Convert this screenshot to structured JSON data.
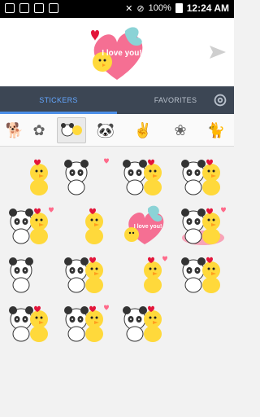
{
  "status": {
    "battery_percent": "100%",
    "time": "12:24 AM"
  },
  "preview": {
    "text": "I love you!"
  },
  "tabs": [
    {
      "label": "STICKERS",
      "active": true
    },
    {
      "label": "FAVORITES",
      "active": false
    }
  ],
  "colors": {
    "tabbar_bg": "#3c4654",
    "active_tab_text": "#63a7ff",
    "accent": "#4c8fe8"
  },
  "packs": [
    {
      "icon": "dog-pack-icon"
    },
    {
      "icon": "rose-pack-icon"
    },
    {
      "icon": "panda-duck-pack-icon",
      "selected": true
    },
    {
      "icon": "panda-pack-icon"
    },
    {
      "icon": "rabbit-pack-icon"
    },
    {
      "icon": "flower-pack-icon"
    },
    {
      "icon": "cat-pack-icon"
    }
  ],
  "stickers": [
    {
      "name": "duck-phone-sticker",
      "text": ""
    },
    {
      "name": "panda-tv-sticker",
      "text": ""
    },
    {
      "name": "panda-salad-sticker",
      "text": ""
    },
    {
      "name": "panda-duck-peek-sticker",
      "text": ""
    },
    {
      "name": "duck-music-sticker",
      "text": ""
    },
    {
      "name": "panda-gift-sticker",
      "text": ""
    },
    {
      "name": "i-love-you-sticker",
      "text": "I love you!"
    },
    {
      "name": "pink-table-sticker",
      "text": ""
    },
    {
      "name": "panda-car-sticker",
      "text": ""
    },
    {
      "name": "panda-cake-sticker",
      "text": ""
    },
    {
      "name": "panda-duck-sit-sticker",
      "text": ""
    },
    {
      "name": "panda-duck-wave-sticker",
      "text": ""
    },
    {
      "name": "panda-guitar-sticker",
      "text": ""
    },
    {
      "name": "panda-duck-hug-sticker",
      "text": ""
    },
    {
      "name": "panda-duck-music-sticker",
      "text": ""
    },
    {
      "name": "duck-panda-purple-sticker",
      "text": ""
    }
  ]
}
